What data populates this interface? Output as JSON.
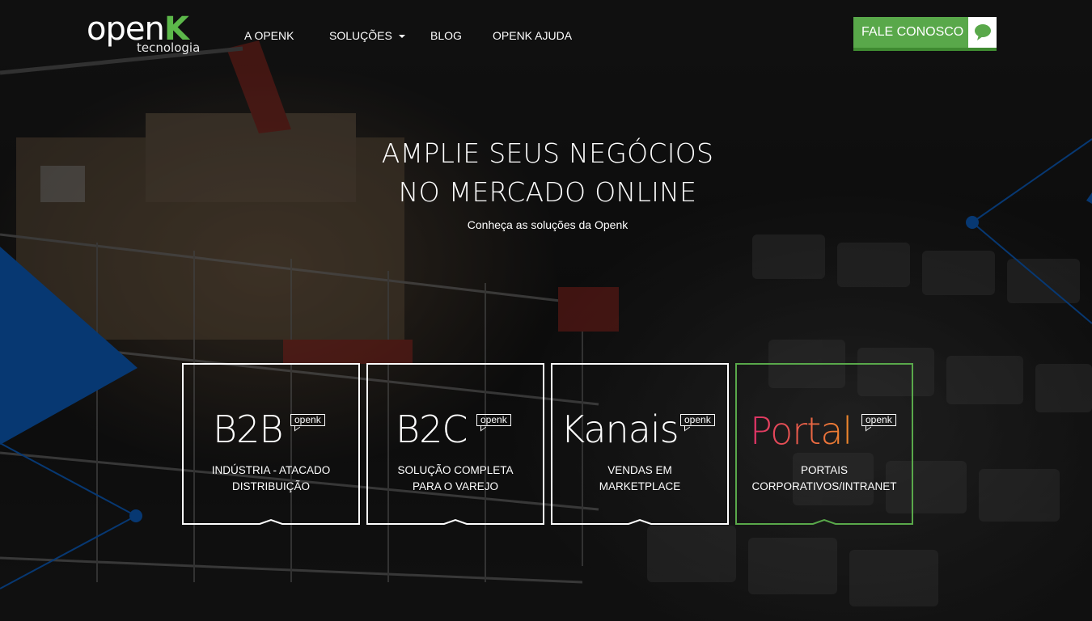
{
  "brand": {
    "logo_main": "open",
    "logo_k": "K",
    "logo_sub": "tecnologia"
  },
  "nav": {
    "items": [
      "A OPENK",
      "SOLUÇÕES",
      "BLOG",
      "OPENK AJUDA"
    ]
  },
  "cta": {
    "label": "FALE CONOSCO",
    "icon": "chat-bubble-icon"
  },
  "hero": {
    "title_line1": "AMPLIE SEUS NEGÓCIOS",
    "title_line2": "NO MERCADO ONLINE",
    "subtitle": "Conheça as soluções da Openk"
  },
  "cards": [
    {
      "name": "B2B",
      "tag": "openk",
      "desc_line1": "INDÚSTRIA - ATACADO",
      "desc_line2": "DISTRIBUIÇÃO"
    },
    {
      "name": "B2C",
      "tag": "openk",
      "desc_line1": "SOLUÇÃO COMPLETA",
      "desc_line2": "PARA O VAREJO"
    },
    {
      "name": "Kanais",
      "tag": "openk",
      "desc_line1": "VENDAS EM",
      "desc_line2": "MARKETPLACE"
    },
    {
      "name": "Portal",
      "tag": "openk",
      "desc_line1": "PORTAIS",
      "desc_line2": "CORPORATIVOS/INTRANET"
    }
  ],
  "colors": {
    "brand_green": "#59a84a",
    "accent_blue": "#0b56b0",
    "portal_gradient_start": "#e0306a",
    "portal_gradient_end": "#f08a2a"
  }
}
